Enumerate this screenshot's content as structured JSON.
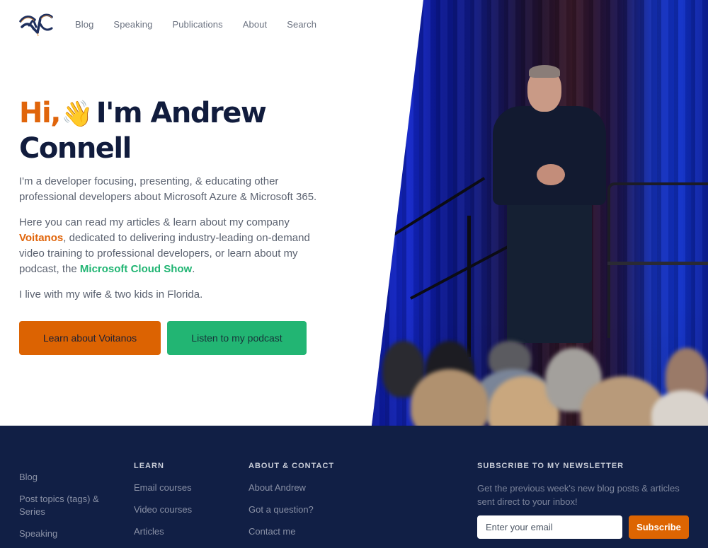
{
  "nav": {
    "logo_alt": "AC logo",
    "links": [
      "Blog",
      "Speaking",
      "Publications",
      "About",
      "Search"
    ]
  },
  "hero": {
    "greeting": "Hi,",
    "wave_emoji": "👋",
    "name_line1": "I'm Andrew",
    "name_line2": "Connell",
    "p1": "I'm a developer focusing, presenting, & educating other professional developers about Microsoft Azure & Microsoft 365.",
    "p2_before": "Here you can read my articles & learn about my company ",
    "p2_company": "Voitanos",
    "p2_middle": ", dedicated to delivering industry-leading on-demand video training to professional developers, or learn about my podcast, the ",
    "p2_podcast": "Microsoft Cloud Show",
    "p2_after": ".",
    "p3": "I live with my wife & two kids in Florida.",
    "btn_voitanos": "Learn about Voitanos",
    "btn_podcast": "Listen to my podcast",
    "photo_alt": "Andrew Connell speaking on stage"
  },
  "colors": {
    "orange": "#e0650b",
    "green": "#22b573",
    "navy": "#111f45",
    "heading": "#111c3d"
  },
  "footer": {
    "col1": {
      "links": [
        "Blog",
        "Post topics (tags) & Series",
        "Speaking"
      ]
    },
    "learn": {
      "heading": "LEARN",
      "links": [
        "Email courses",
        "Video courses",
        "Articles"
      ]
    },
    "about": {
      "heading": "ABOUT & CONTACT",
      "links": [
        "About Andrew",
        "Got a question?",
        "Contact me"
      ]
    },
    "newsletter": {
      "heading": "SUBSCRIBE TO MY NEWSLETTER",
      "description": "Get the previous week's new blog posts & articles sent direct to your inbox!",
      "email_placeholder": "Enter your email",
      "email_value": "",
      "subscribe_label": "Subscribe"
    }
  }
}
